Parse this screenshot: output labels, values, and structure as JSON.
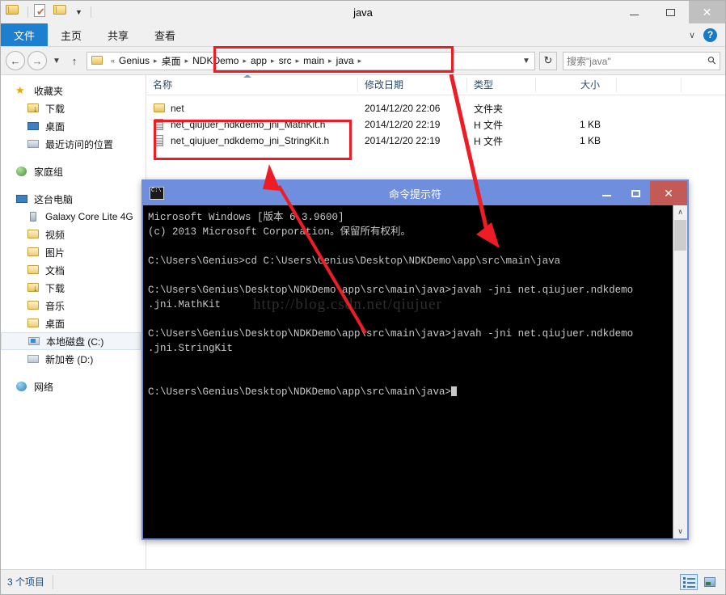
{
  "window": {
    "title": "java",
    "minimize_label": "最小化",
    "maximize_label": "最大化",
    "close_label": "关闭"
  },
  "quick_access": {
    "items": [
      {
        "name": "folder-properties-icon",
        "label": "属性"
      },
      {
        "name": "new-folder-icon",
        "label": "新建文件夹"
      },
      {
        "name": "customize-icon",
        "label": "自定义快速访问工具栏"
      }
    ]
  },
  "ribbon": {
    "tabs": [
      {
        "label": "文件",
        "active": true
      },
      {
        "label": "主页",
        "active": false
      },
      {
        "label": "共享",
        "active": false
      },
      {
        "label": "查看",
        "active": false
      }
    ],
    "collapse_label": "∨",
    "help_label": "?"
  },
  "address": {
    "back_label": "←",
    "forward_label": "→",
    "recent_label": "∨",
    "up_label": "↑",
    "root_glyph": "«",
    "crumbs": [
      "Genius",
      "桌面",
      "NDKDemo",
      "app",
      "src",
      "main",
      "java"
    ],
    "separator": "▸",
    "dropdown_label": "∨",
    "refresh_label": "↻"
  },
  "search": {
    "placeholder": "搜索\"java\"",
    "icon": "search-icon"
  },
  "navpane": {
    "groups": [
      {
        "header": {
          "label": "收藏夹",
          "icon": "star-icon"
        },
        "items": [
          {
            "label": "下载",
            "icon": "download-folder-icon"
          },
          {
            "label": "桌面",
            "icon": "desktop-icon"
          },
          {
            "label": "最近访问的位置",
            "icon": "recent-places-icon"
          }
        ]
      },
      {
        "header": {
          "label": "家庭组",
          "icon": "homegroup-icon"
        },
        "items": []
      },
      {
        "header": {
          "label": "这台电脑",
          "icon": "this-pc-icon"
        },
        "items": [
          {
            "label": "Galaxy Core Lite 4G",
            "icon": "phone-icon"
          },
          {
            "label": "视频",
            "icon": "videos-folder-icon"
          },
          {
            "label": "图片",
            "icon": "pictures-folder-icon"
          },
          {
            "label": "文档",
            "icon": "documents-folder-icon"
          },
          {
            "label": "下载",
            "icon": "download-folder-icon"
          },
          {
            "label": "音乐",
            "icon": "music-folder-icon"
          },
          {
            "label": "桌面",
            "icon": "desktop-folder-icon"
          },
          {
            "label": "本地磁盘 (C:)",
            "icon": "local-disk-icon",
            "selected": true
          },
          {
            "label": "新加卷 (D:)",
            "icon": "volume-icon"
          }
        ]
      },
      {
        "header": {
          "label": "网络",
          "icon": "network-icon"
        },
        "items": []
      }
    ]
  },
  "filelist": {
    "columns": [
      {
        "label": "名称",
        "sorted": "asc"
      },
      {
        "label": "修改日期"
      },
      {
        "label": "类型"
      },
      {
        "label": "大小"
      }
    ],
    "rows": [
      {
        "name": "net",
        "icon": "folder-icon",
        "date": "2014/12/20 22:06",
        "type": "文件夹",
        "size": ""
      },
      {
        "name": "net_qiujuer_ndkdemo_jni_MathKit.h",
        "icon": "h-file-icon",
        "date": "2014/12/20 22:19",
        "type": "H 文件",
        "size": "1 KB"
      },
      {
        "name": "net_qiujuer_ndkdemo_jni_StringKit.h",
        "icon": "h-file-icon",
        "date": "2014/12/20 22:19",
        "type": "H 文件",
        "size": "1 KB"
      }
    ]
  },
  "statusbar": {
    "count_text": "3 个项目",
    "view_details_label": "详细信息",
    "view_thumbnails_label": "大图标"
  },
  "cmd": {
    "title": "命令提示符",
    "icon_text": "C:\\",
    "minimize_label": "最小化",
    "maximize_label": "最大化",
    "close_label": "关闭",
    "console_text": "Microsoft Windows [版本 6.3.9600]\n(c) 2013 Microsoft Corporation。保留所有权利。\n\nC:\\Users\\Genius>cd C:\\Users\\Genius\\Desktop\\NDKDemo\\app\\src\\main\\java\n\nC:\\Users\\Genius\\Desktop\\NDKDemo\\app\\src\\main\\java>javah -jni net.qiujuer.ndkdemo\n.jni.MathKit\n\nC:\\Users\\Genius\\Desktop\\NDKDemo\\app\\src\\main\\java>javah -jni net.qiujuer.ndkdemo\n.jni.StringKit\n\n\nC:\\Users\\Genius\\Desktop\\NDKDemo\\app\\src\\main\\java>",
    "scroll_up_label": "∧",
    "scroll_down_label": "∨"
  },
  "watermark": {
    "text": "http://blog.csdn.net/qiujuer"
  },
  "annotations": {
    "color": "#ee1c25",
    "boxes": [
      {
        "name": "breadcrumb-highlight",
        "target": "NDKDemo ▸ app ▸ src ▸ main ▸ java ▸"
      },
      {
        "name": "generated-headers-highlight",
        "target": "net_qiujuer_ndkdemo_jni_MathKit.h / net_qiujuer_ndkdemo_jni_StringKit.h"
      }
    ],
    "arrows": [
      {
        "name": "arrow-files-to-command",
        "direction": "up"
      },
      {
        "name": "arrow-path-to-console",
        "direction": "down"
      }
    ]
  }
}
